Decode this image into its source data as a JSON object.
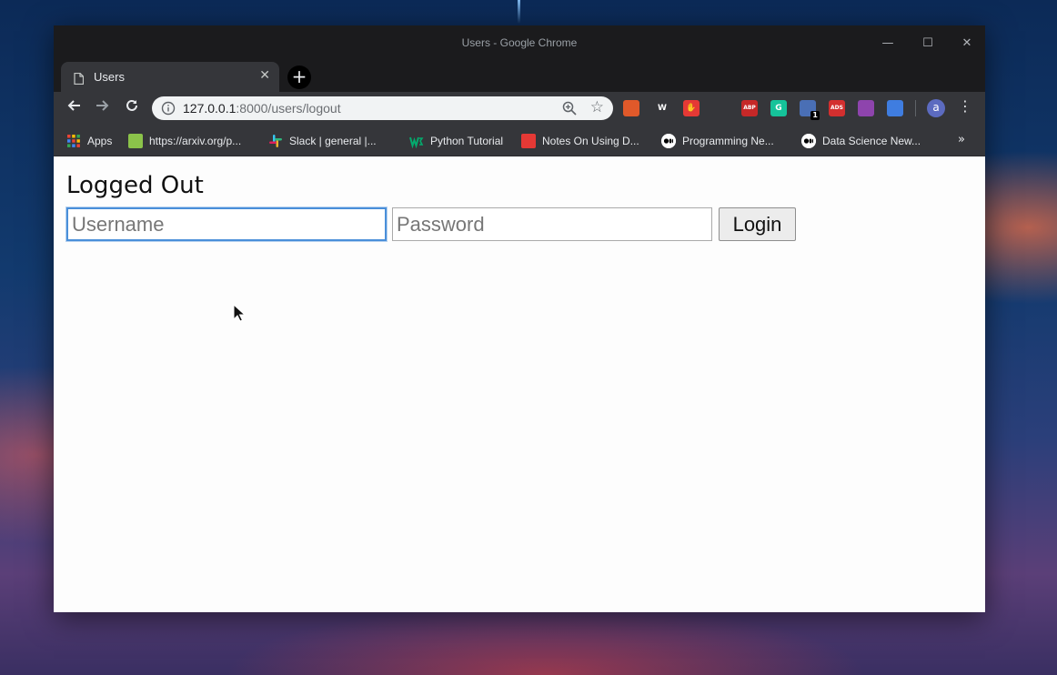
{
  "window": {
    "title": "Users - Google Chrome"
  },
  "tab": {
    "title": "Users"
  },
  "address_bar": {
    "host": "127.0.0.1",
    "path": ":8000/users/logout"
  },
  "bookmarks": [
    {
      "label": "Apps",
      "color": "#4285f4"
    },
    {
      "label": "https://arxiv.org/p...",
      "color": "#8bc34a"
    },
    {
      "label": "Slack | general |...",
      "color": "#e01e5a"
    },
    {
      "label": "Python Tutorial",
      "color": "#04aa6d"
    },
    {
      "label": "Notes On Using D...",
      "color": "#e53935"
    },
    {
      "label": "Programming Ne...",
      "color": "#000000"
    },
    {
      "label": "Data Science New...",
      "color": "#000000"
    }
  ],
  "extensions": [
    {
      "name": "ext-orange-icon",
      "text": "",
      "color": "#e0592a"
    },
    {
      "name": "ext-w-icon",
      "text": "W",
      "color": "#35363a"
    },
    {
      "name": "ext-hand-icon",
      "text": "✋",
      "color": "#e53935"
    },
    {
      "name": "ext-gnome-icon",
      "text": "",
      "color": "#35363a"
    },
    {
      "name": "ext-abp-icon",
      "text": "ABP",
      "color": "#c62828"
    },
    {
      "name": "ext-grammarly-icon",
      "text": "G",
      "color": "#15c39a"
    },
    {
      "name": "ext-diamond-icon",
      "text": "",
      "color": "#4a6fb5",
      "badge": "1"
    },
    {
      "name": "ext-ads-icon",
      "text": "ADS",
      "color": "#d32f2f"
    },
    {
      "name": "ext-grid-icon",
      "text": "",
      "color": "#8e44ad"
    },
    {
      "name": "ext-window-icon",
      "text": "",
      "color": "#3f7de0"
    }
  ],
  "avatar": {
    "initial": "a"
  },
  "page": {
    "heading": "Logged Out",
    "username_placeholder": "Username",
    "password_placeholder": "Password",
    "login_label": "Login"
  }
}
